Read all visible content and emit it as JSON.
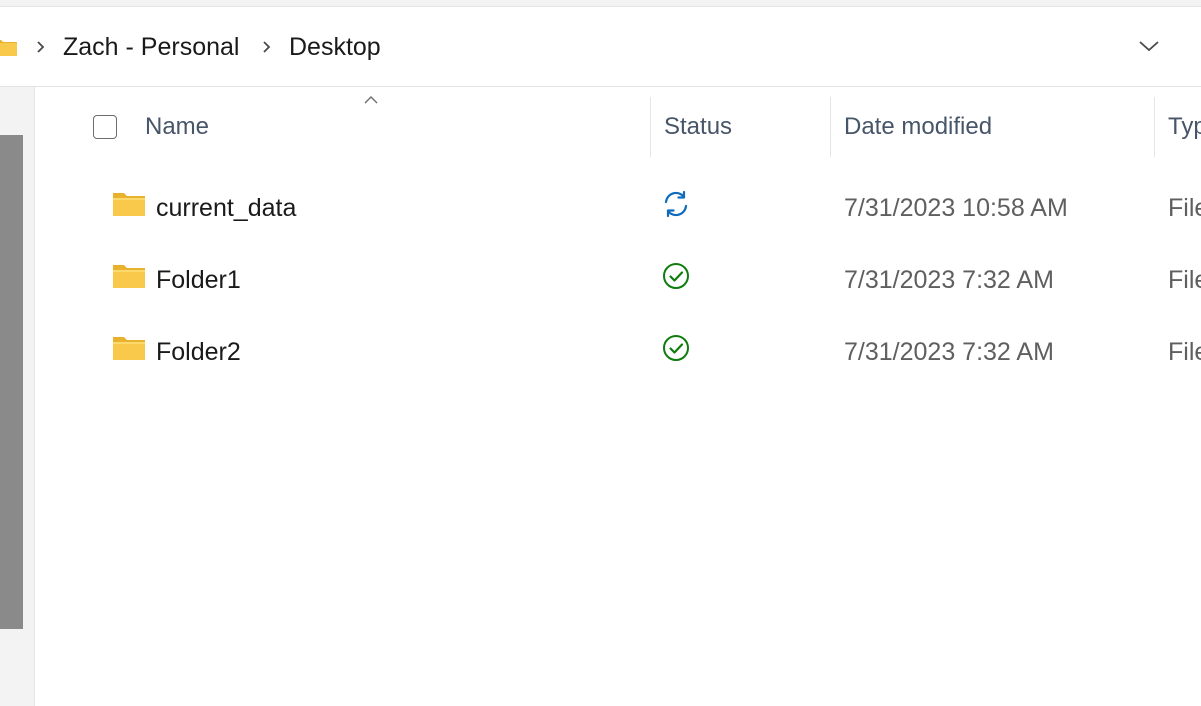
{
  "breadcrumb": {
    "items": [
      {
        "label": "Zach - Personal"
      },
      {
        "label": "Desktop"
      }
    ]
  },
  "columns": {
    "name": "Name",
    "status": "Status",
    "date_modified": "Date modified",
    "type": "Typ"
  },
  "files": [
    {
      "name": "current_data",
      "status": "syncing",
      "date": "7/31/2023 10:58 AM",
      "type": "File"
    },
    {
      "name": "Folder1",
      "status": "synced",
      "date": "7/31/2023 7:32 AM",
      "type": "File"
    },
    {
      "name": "Folder2",
      "status": "synced",
      "date": "7/31/2023 7:32 AM",
      "type": "File"
    }
  ],
  "colors": {
    "folder_yellow": "#f8c94a",
    "sync_blue": "#0f6cbd",
    "synced_green": "#107c10"
  }
}
